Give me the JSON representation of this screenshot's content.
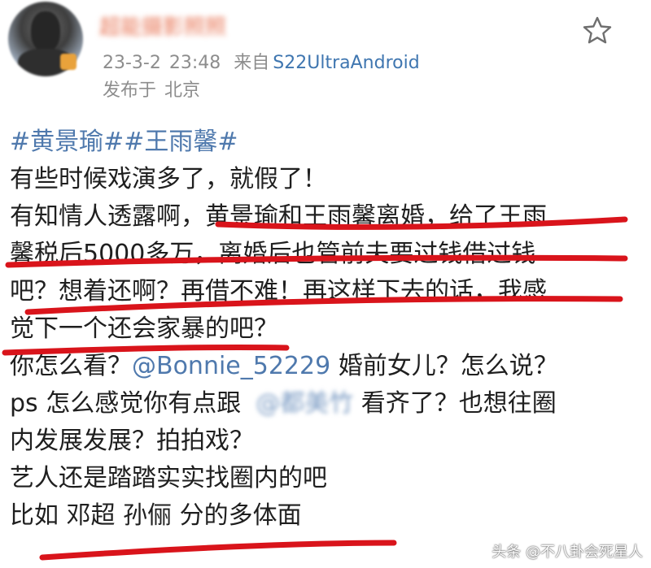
{
  "post": {
    "username": "超能摄影照照",
    "date": "23-3-2",
    "time": "23:48",
    "source_prefix": "来自",
    "source_device": "S22UltraAndroid",
    "location_prefix": "发布于",
    "location": "北京",
    "topics": "#黄景瑜##王雨馨#",
    "lines": [
      "有些时候戏演多了，就假了！",
      "有知情人透露啊，黄景瑜和王雨馨离婚，给了王雨",
      "馨税后5000多万，离婚后也管前夫要过钱借过钱",
      "吧？想着还啊？再借不难！再这样下去的话，我感",
      "觉下一个还会家暴的吧？"
    ],
    "line6_before": "你怎么看？",
    "line6_mention": "@Bonnie_52229",
    "line6_after": " 婚前女儿？怎么说？",
    "line7_before": "ps 怎么感觉你有点跟",
    "line7_mention": "@都美竹",
    "line7_after": " 看齐了？也想往圈",
    "lines_tail": [
      "内发展发展？拍拍戏？",
      "艺人还是踏踏实实找圈内的吧",
      "比如 邓超 孙俪 分的多体面"
    ]
  },
  "actions": {
    "favorite_icon": "star-outline-icon"
  },
  "watermark": "头条 @不八卦会死星人",
  "colors": {
    "topic_blue": "#4f79ad",
    "meta_gray": "#8d8d8d",
    "underline_red": "#d9141b"
  }
}
